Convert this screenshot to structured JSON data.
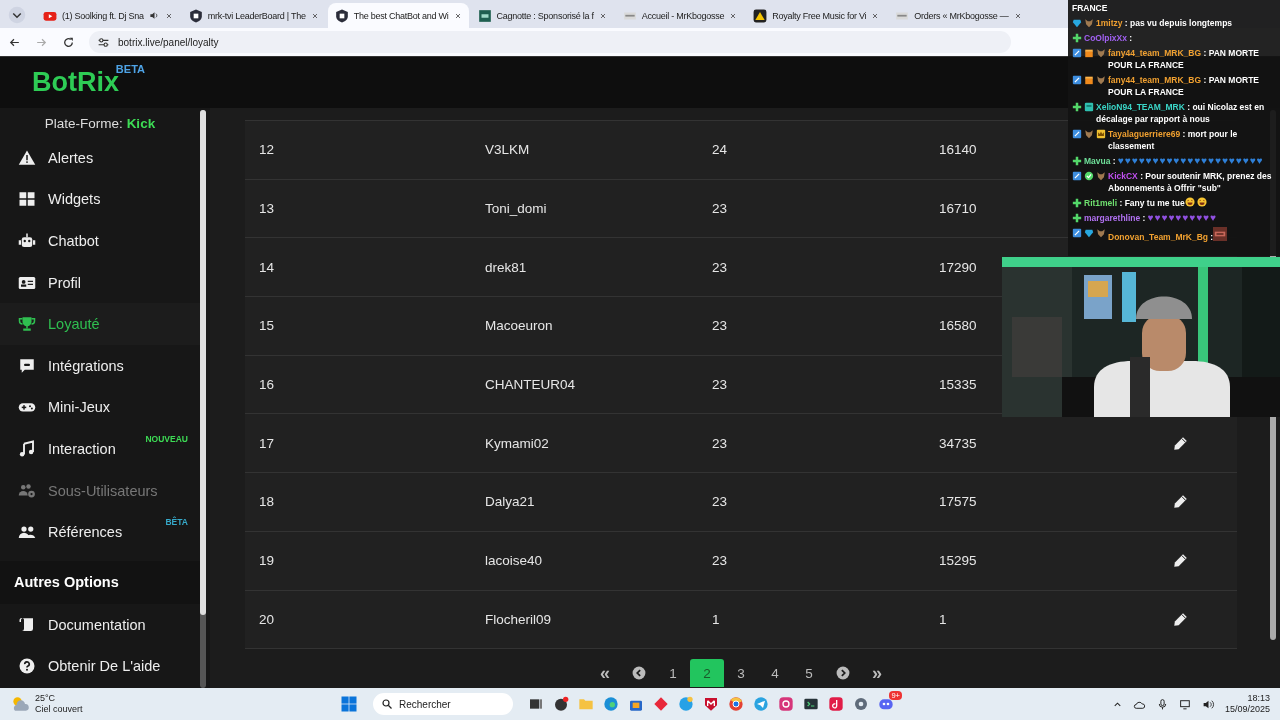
{
  "browser": {
    "tabs": [
      {
        "title": "(1) Soolking ft. Dj Sna",
        "audio": true,
        "selected": false
      },
      {
        "title": "mrk-tvi LeaderBoard | The",
        "audio": false,
        "selected": false
      },
      {
        "title": "The best ChatBot and Wi",
        "audio": false,
        "selected": true
      },
      {
        "title": "Cagnotte : Sponsorisé la f",
        "audio": false,
        "selected": false
      },
      {
        "title": "Accueil - MrKbogosse",
        "audio": false,
        "selected": false
      },
      {
        "title": "Royalty Free Music for Vi",
        "audio": false,
        "selected": false
      },
      {
        "title": "Orders « MrKbogosse —",
        "audio": false,
        "selected": false
      }
    ],
    "address": "botrix.live/panel/loyalty"
  },
  "header": {
    "logo": "BotRix",
    "logo_badge": "BETA"
  },
  "sidebar": {
    "platform_label": "Plate-Forme:",
    "platform": "Kick",
    "items": [
      {
        "label": "Alertes",
        "selected": false,
        "disabled": false
      },
      {
        "label": "Widgets",
        "selected": false,
        "disabled": false
      },
      {
        "label": "Chatbot",
        "selected": false,
        "disabled": false
      },
      {
        "label": "Profil",
        "selected": false,
        "disabled": false
      },
      {
        "label": "Loyauté",
        "selected": true,
        "disabled": false
      },
      {
        "label": "Intégrations",
        "selected": false,
        "disabled": false
      },
      {
        "label": "Mini-Jeux",
        "selected": false,
        "disabled": false
      },
      {
        "label": "Interaction",
        "selected": false,
        "disabled": false,
        "badge": {
          "text": "NOUVEAU",
          "kind": "new"
        }
      },
      {
        "label": "Sous-Utilisateurs",
        "selected": false,
        "disabled": true
      },
      {
        "label": "Références",
        "selected": false,
        "disabled": false,
        "badge": {
          "text": "BÊTA",
          "kind": "beta"
        }
      }
    ],
    "section_title": "Autres Options",
    "other_items": [
      {
        "label": "Documentation",
        "selected": false,
        "disabled": false
      },
      {
        "label": "Obtenir De L'aide",
        "selected": false,
        "disabled": false
      }
    ]
  },
  "table": {
    "rows": [
      {
        "rank": "12",
        "name": "V3LKM",
        "column_3": "24",
        "column_4": "16140"
      },
      {
        "rank": "13",
        "name": "Toni_domi",
        "column_3": "23",
        "column_4": "16710"
      },
      {
        "rank": "14",
        "name": "drek81",
        "column_3": "23",
        "column_4": "17290"
      },
      {
        "rank": "15",
        "name": "Macoeuron",
        "column_3": "23",
        "column_4": "16580"
      },
      {
        "rank": "16",
        "name": "CHANTEUR04",
        "column_3": "23",
        "column_4": "15335"
      },
      {
        "rank": "17",
        "name": "Kymami02",
        "column_3": "23",
        "column_4": "34735",
        "edit_icon": true
      },
      {
        "rank": "18",
        "name": "Dalya21",
        "column_3": "23",
        "column_4": "17575",
        "edit_icon": true
      },
      {
        "rank": "19",
        "name": "lacoise40",
        "column_3": "23",
        "column_4": "15295",
        "edit_icon": true
      },
      {
        "rank": "20",
        "name": "Flocheril09",
        "column_3": "1",
        "column_4": "1",
        "edit_icon": true
      }
    ]
  },
  "pagination": {
    "first": "«",
    "last": "»",
    "pages": [
      {
        "label": "1",
        "selected": false
      },
      {
        "label": "2",
        "selected": true
      },
      {
        "label": "3",
        "selected": false
      },
      {
        "label": "4",
        "selected": false
      },
      {
        "label": "5",
        "selected": false
      }
    ]
  },
  "chat": {
    "messages": [
      {
        "text": "FRANCE"
      },
      {
        "user": "1mitzy",
        "text": ": pas vu depuis longtemps"
      },
      {
        "user": "CoOlpixXx",
        "text": ":"
      },
      {
        "user": "fany44_team_MRK_BG",
        "text": ": PAN MORTE POUR LA FRANCE"
      },
      {
        "user": "fany44_team_MRK_BG",
        "text": ": PAN MORTE POUR LA FRANCE"
      },
      {
        "user": "XelioN94_TEAM_MRK",
        "text": ": oui Nicolaz est en décalage par rapport à nous"
      },
      {
        "user": "Tayalaguerriere69",
        "text": ": mort pour le classement"
      },
      {
        "user": "Mavua",
        "text": ":",
        "hearts": "♥♥♥♥♥♥♥♥♥♥♥♥♥♥♥♥♥♥♥♥♥"
      },
      {
        "user": "KickCX",
        "text": ": Pour soutenir MRK, prenez des Abonnements à Offrir \"sub\""
      },
      {
        "user": "Rit1meli",
        "text": ": Fany tu me tue"
      },
      {
        "user": "margarethline",
        "text": ":",
        "hearts": "♥♥♥♥♥♥♥♥♥♥"
      },
      {
        "user": "Donovan_Team_MrK_Bg",
        "text": ":"
      }
    ]
  },
  "taskbar": {
    "temperature": "25°C",
    "weather": "Ciel couvert",
    "search": "Rechercher",
    "discord_badge": "9+",
    "time": "18:13",
    "date": "15/09/2025"
  }
}
